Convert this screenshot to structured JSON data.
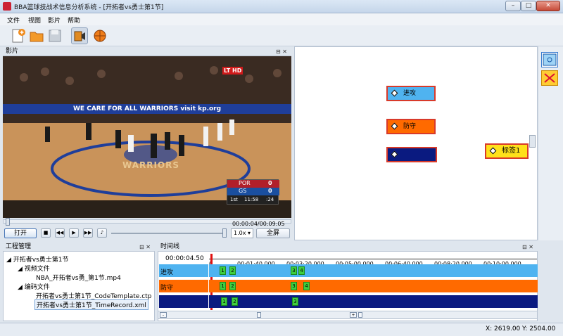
{
  "window": {
    "title": "BBA篮球技战术信息分析系统 - [开拓者vs勇士第1节]",
    "min": "–",
    "max": "□",
    "close": "✕"
  },
  "menu": [
    "文件",
    "视图",
    "影片",
    "帮助"
  ],
  "panels": {
    "video_title": "影片",
    "tree_title": "工程管理",
    "timeline_title": "时间线"
  },
  "video": {
    "banner": "WE CARE FOR ALL WARRIORS  visit kp.org",
    "channel": "LT HD",
    "court_text": "WARRIORS",
    "score": {
      "team1": "POR",
      "score1": "0",
      "team2": "GS",
      "score2": "0",
      "period": "1st",
      "clock": "11:58",
      "shot": ":24"
    }
  },
  "player": {
    "time": "00:00:04/00:09:05",
    "open_label": "打开",
    "speed": "1.0x",
    "fullscreen_label": "全屏",
    "progress": 0.007
  },
  "diagram": {
    "nodes": [
      "进攻",
      "防守",
      "",
      "标签1"
    ]
  },
  "tree": {
    "root": "开拓者vs勇士第1节",
    "video_folder": "视频文件",
    "video_file": "NBA_开拓者vs勇_第1节.mp4",
    "code_folder": "编码文件",
    "code_file1": "开拓者vs勇士第1节_CodeTemplate.ctp",
    "code_file2": "开拓者vs勇士第1节_TimeRecord.xml"
  },
  "timeline": {
    "current": "00:00:04.50",
    "ticks": [
      "0",
      "00:01:40.000",
      "00:03:20.000",
      "00:05:00.000",
      "00:06:40.000",
      "00:08:20.000",
      "00:10:00.000"
    ],
    "tracks": [
      {
        "label": "进攻",
        "color": "#4fb3f0",
        "clips": [
          "1",
          "2",
          "3",
          "4"
        ]
      },
      {
        "label": "防守",
        "color": "#ff6a00",
        "clips": [
          "1",
          "2",
          "3",
          "4"
        ]
      },
      {
        "label": "",
        "color": "#0a1a80",
        "clips": [
          "1",
          "2",
          "3"
        ]
      }
    ]
  },
  "status": {
    "x": "X: 2619.00",
    "y": "Y: 2504.00"
  },
  "colors": {
    "attack": "#4fb3f0",
    "defense": "#ff6a00",
    "other": "#0a1a80",
    "label": "#ffe11a",
    "clip": "#3fce3f"
  }
}
